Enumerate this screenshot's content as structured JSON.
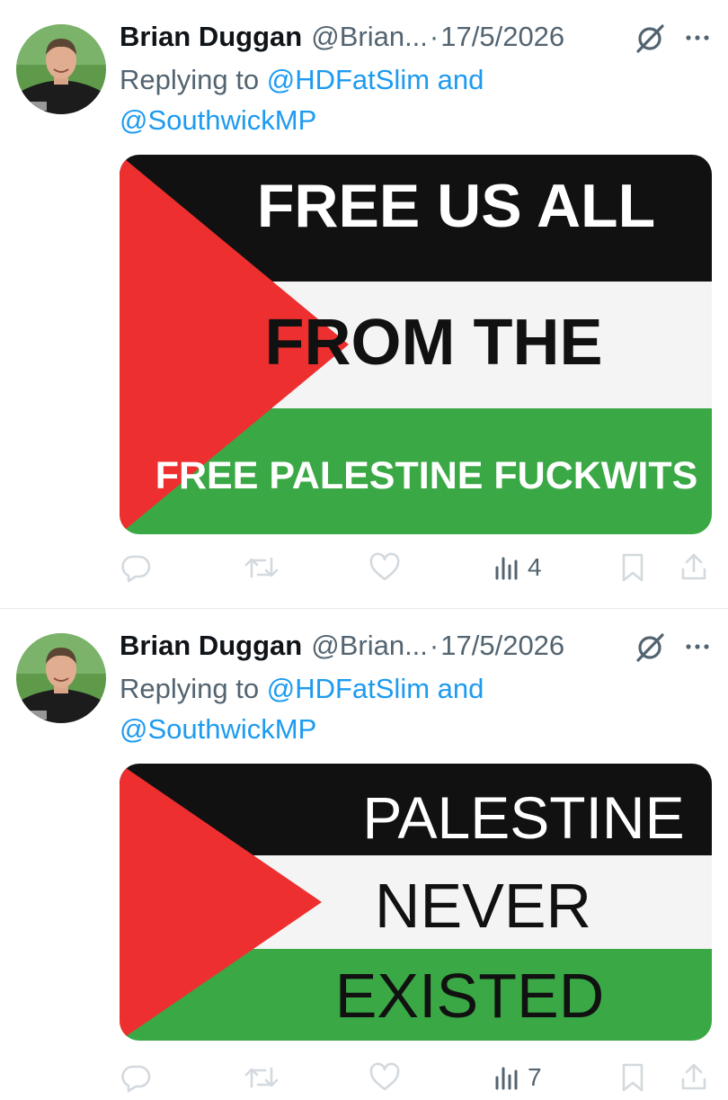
{
  "tweets": [
    {
      "author_name": "Brian Duggan",
      "handle": "@Brian...",
      "separator": "·",
      "date": "17/5/2026",
      "reply_prefix": "Replying to",
      "mention1": "@HDFatSlim",
      "conj": "and",
      "mention2": "@SouthwickMP",
      "image_text": [
        "FREE US ALL",
        "FROM THE",
        "FREE PALESTINE FUCKWITS"
      ],
      "views": "4",
      "icons": [
        "reply-icon",
        "retweet-icon",
        "like-icon",
        "views-icon",
        "bookmark-icon",
        "share-icon"
      ]
    },
    {
      "author_name": "Brian Duggan",
      "handle": "@Brian...",
      "separator": "·",
      "date": "17/5/2026",
      "reply_prefix": "Replying to",
      "mention1": "@HDFatSlim",
      "conj": "and",
      "mention2": "@SouthwickMP",
      "image_text": [
        "PALESTINE",
        "NEVER",
        "EXISTED"
      ],
      "views": "7",
      "icons": [
        "reply-icon",
        "retweet-icon",
        "like-icon",
        "views-icon",
        "bookmark-icon",
        "share-icon"
      ]
    }
  ],
  "colors": {
    "text_primary": "#0f1419",
    "text_secondary": "#536471",
    "link": "#1d9bf0",
    "flag_red": "#ee2f2f",
    "flag_black": "#111111",
    "flag_white": "#f4f4f4",
    "flag_green": "#3aa845"
  }
}
